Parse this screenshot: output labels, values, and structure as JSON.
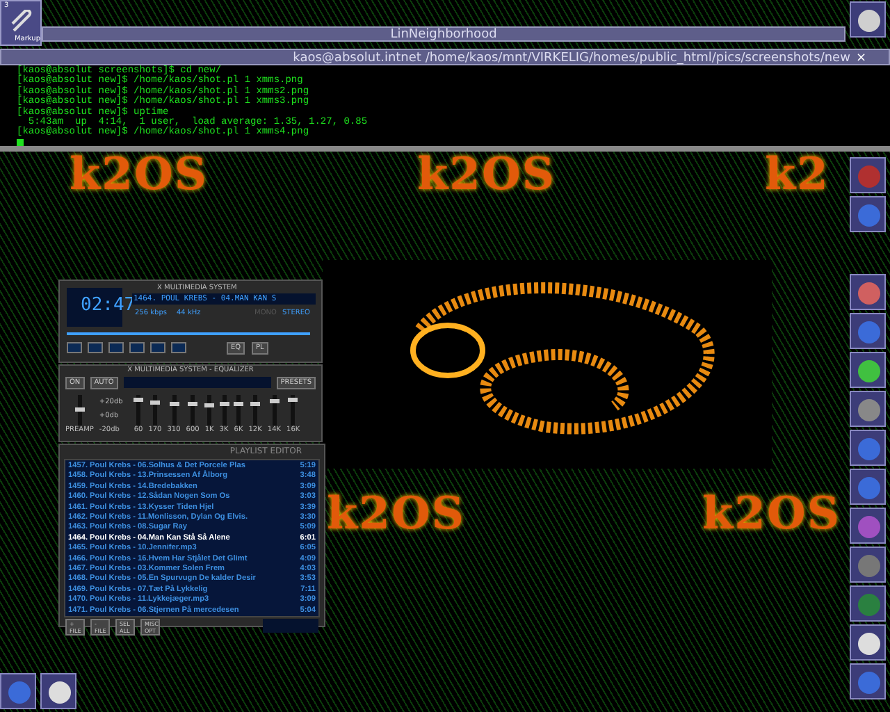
{
  "desktop_icon": {
    "number": "3",
    "label": "Markup"
  },
  "linneighborhood": {
    "title": "LinNeighborhood"
  },
  "terminal": {
    "title": "kaos@absolut.intnet /home/kaos/mnt/VIRKELIG/homes/public_html/pics/screenshots/new",
    "close": "×",
    "lines": [
      "[kaos@absolut screenshots]$ cd new/",
      "[kaos@absolut new]$ /home/kaos/shot.pl 1 xmms.png",
      "[kaos@absolut new]$ /home/kaos/shot.pl 1 xmms2.png",
      "[kaos@absolut new]$ /home/kaos/shot.pl 1 xmms3.png",
      "[kaos@absolut new]$ uptime",
      "  5:43am  up  4:14,  1 user,  load average: 1.35, 1.27, 0.85",
      "[kaos@absolut new]$ /home/kaos/shot.pl 1 xmms4.png"
    ]
  },
  "banners": [
    {
      "text": "k2OS"
    },
    {
      "text": "k2OS"
    },
    {
      "text": "k2"
    },
    {
      "text": "k2OS"
    },
    {
      "text": "k2OS"
    }
  ],
  "player": {
    "title": "X MULTIMEDIA SYSTEM",
    "time": "02:47",
    "song": "1464. POUL KREBS - 04.MAN KAN S",
    "kbps": "256 kbps",
    "khz": "44 kHz",
    "stereo_labels": [
      "MONO",
      "STEREO"
    ],
    "toggles": [
      "EQ",
      "PL"
    ]
  },
  "equalizer": {
    "title": "X MULTIMEDIA SYSTEM - EQUALIZER",
    "buttons": [
      "ON",
      "AUTO"
    ],
    "presets": "PRESETS",
    "scale": [
      "+20db",
      "+0db",
      "-20db"
    ],
    "preamp": {
      "label": "PREAMP",
      "level": 0.5
    },
    "bands": [
      {
        "label": "60",
        "level": 0.85
      },
      {
        "label": "170",
        "level": 0.75
      },
      {
        "label": "310",
        "level": 0.7
      },
      {
        "label": "600",
        "level": 0.7
      },
      {
        "label": "1K",
        "level": 0.68
      },
      {
        "label": "3K",
        "level": 0.7
      },
      {
        "label": "6K",
        "level": 0.7
      },
      {
        "label": "12K",
        "level": 0.72
      },
      {
        "label": "14K",
        "level": 0.8
      },
      {
        "label": "16K",
        "level": 0.85
      }
    ]
  },
  "playlist": {
    "title": "PLAYLIST EDITOR",
    "items": [
      {
        "text": "1457. Poul Krebs - 06.Solhus & Det Porcele Plas",
        "time": "5:19",
        "selected": false
      },
      {
        "text": "1458. Poul Krebs - 13.Prinsessen Af Ålborg",
        "time": "3:48",
        "selected": false
      },
      {
        "text": "1459. Poul Krebs - 14.Bredebakken",
        "time": "3:09",
        "selected": false
      },
      {
        "text": "1460. Poul Krebs - 12.Sådan Nogen Som Os",
        "time": "3:03",
        "selected": false
      },
      {
        "text": "1461. Poul Krebs - 13.Kysser Tiden Hjel",
        "time": "3:39",
        "selected": false
      },
      {
        "text": "1462. Poul Krebs - 11.Monlisson, Dylan Og Elvis.",
        "time": "3:30",
        "selected": false
      },
      {
        "text": "1463. Poul Krebs - 08.Sugar Ray",
        "time": "5:09",
        "selected": false
      },
      {
        "text": "1464. Poul Krebs - 04.Man Kan Stå Så Alene",
        "time": "6:01",
        "selected": true
      },
      {
        "text": "1465. Poul Krebs - 10.Jennifer.mp3",
        "time": "6:05",
        "selected": false
      },
      {
        "text": "1466. Poul Krebs - 16.Hvem Har Stjålet Det Glimt",
        "time": "4:09",
        "selected": false
      },
      {
        "text": "1467. Poul Krebs - 03.Kommer Solen Frem",
        "time": "4:03",
        "selected": false
      },
      {
        "text": "1468. Poul Krebs - 05.En Spurvugn De kalder Desir",
        "time": "3:53",
        "selected": false
      },
      {
        "text": "1469. Poul Krebs - 07.Tæt På Lykkelig",
        "time": "7:11",
        "selected": false
      },
      {
        "text": "1470. Poul Krebs - 11.Lykkejæger.mp3",
        "time": "3:09",
        "selected": false
      },
      {
        "text": "1471. Poul Krebs - 06.Stjernen På mercedesen",
        "time": "5:04",
        "selected": false
      }
    ],
    "buttons": [
      "+ FILE",
      "- FILE",
      "SEL ALL",
      "MISC OPT"
    ]
  }
}
